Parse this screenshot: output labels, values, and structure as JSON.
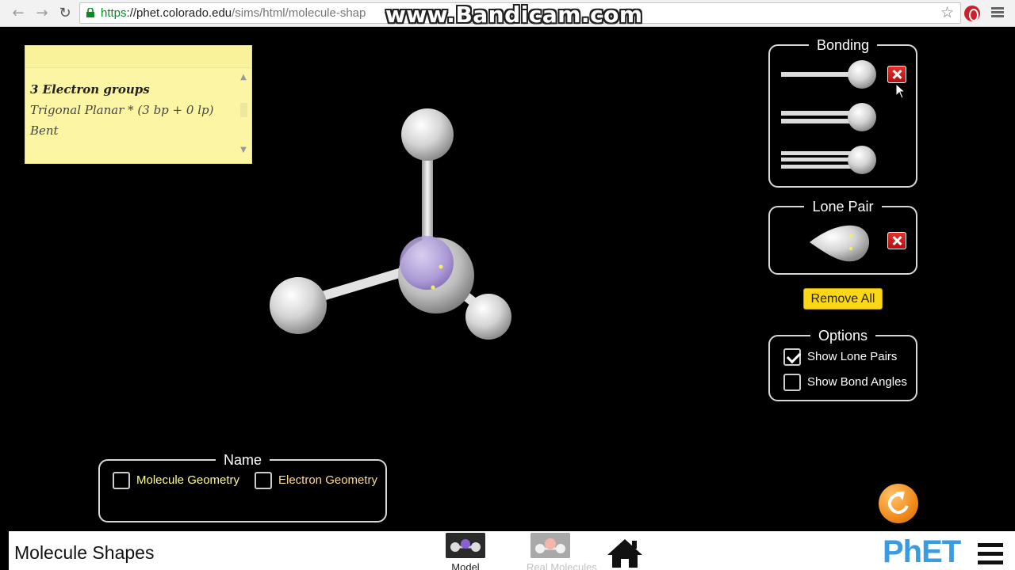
{
  "browser": {
    "url_scheme": "https",
    "url_host": "://phet.colorado.edu",
    "url_path": "/sims/html/molecule-shap",
    "watermark": "www.Bandicam.com"
  },
  "note": {
    "lines": [
      "3 Electron groups",
      "Trigonal Planar * (3 bp + 0 lp)",
      "Bent"
    ]
  },
  "bonding": {
    "title": "Bonding"
  },
  "lone_pair": {
    "title": "Lone Pair"
  },
  "remove_all_label": "Remove All",
  "options": {
    "title": "Options",
    "show_lone_pairs": "Show Lone Pairs",
    "show_lone_pairs_checked": true,
    "show_bond_angles": "Show Bond Angles",
    "show_bond_angles_checked": false
  },
  "name_panel": {
    "title": "Name",
    "molecule_geometry": "Molecule Geometry",
    "electron_geometry": "Electron Geometry"
  },
  "footer": {
    "sim_title": "Molecule Shapes",
    "screens": [
      "Model",
      "Real Molecules"
    ],
    "logo": "PhET"
  },
  "colors": {
    "accent_button": "#fcd716",
    "remove_button": "#d81f1a",
    "central_atom": "#a58fd6",
    "molecule_geometry_text": "#ffff8c",
    "electron_geometry_text": "#ffdc8a"
  }
}
